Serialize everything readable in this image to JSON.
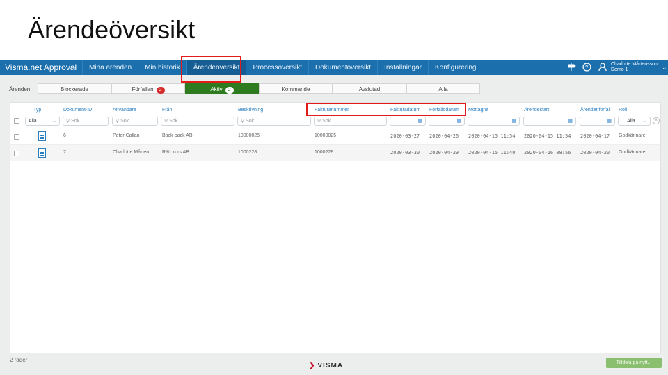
{
  "slide": {
    "title": "Ärendeöversikt"
  },
  "app": {
    "brand": "Visma.net Approval",
    "nav": [
      "Mina ärenden",
      "Min historik",
      "Ärendeöversikt",
      "Processöversikt",
      "Dokumentöversikt",
      "Inställningar",
      "Konfigurering"
    ],
    "active_nav": "Ärendeöversikt",
    "user": {
      "name": "Charlotte Mårtensson",
      "company": "Demo 1"
    }
  },
  "tabs": {
    "label": "Ärenden",
    "items": [
      {
        "label": "Blockerade",
        "badge": ""
      },
      {
        "label": "Förfallen",
        "badge": "2"
      },
      {
        "label": "Aktiv",
        "badge": "2"
      },
      {
        "label": "Kommande",
        "badge": ""
      },
      {
        "label": "Avslutad",
        "badge": ""
      },
      {
        "label": "Alla",
        "badge": ""
      }
    ],
    "active": "Aktiv"
  },
  "grid": {
    "columns": [
      "Typ",
      "Dokument-ID",
      "Användare",
      "Från",
      "Beskrivning",
      "Fakturanummer",
      "Fakturadatum",
      "Förfallodatum",
      "Mottagna",
      "Ärendestart",
      "Ärendet förfall",
      "Roll"
    ],
    "filters": {
      "typ": "Alla",
      "search_placeholder": "Sök...",
      "roll": "Alla"
    },
    "rows": [
      {
        "dokument_id": "6",
        "anvandare": "Peter Callan",
        "fran": "Back-pack AB",
        "beskrivning": "10000025",
        "fakturanummer": "10000025",
        "fakturadatum": "2020-03-27",
        "forfallodatum": "2020-04-26",
        "mottagna": "2020-04-15 11:54",
        "arendestart": "2020-04-15 11:54",
        "arendet_forfall": "2020-04-17",
        "roll": "Godkännare"
      },
      {
        "dokument_id": "7",
        "anvandare": "Charlotte Mårten...",
        "fran": "Rätt kurs AB",
        "beskrivning": "1000228",
        "fakturanummer": "1000228",
        "fakturadatum": "2020-03-30",
        "forfallodatum": "2020-04-29",
        "mottagna": "2020-04-15 11:40",
        "arendestart": "2020-04-16 08:56",
        "arendet_forfall": "2020-04-20",
        "roll": "Godkännare"
      }
    ]
  },
  "footer": {
    "count": "2 rader",
    "logo": "VISMA",
    "assign_button": "Tilldela på nytt..."
  },
  "colors": {
    "nav_bg": "#1b6fad",
    "active_tab": "#2d7a1f",
    "highlight": "#e21a1a",
    "header_text": "#2a7fc1"
  }
}
